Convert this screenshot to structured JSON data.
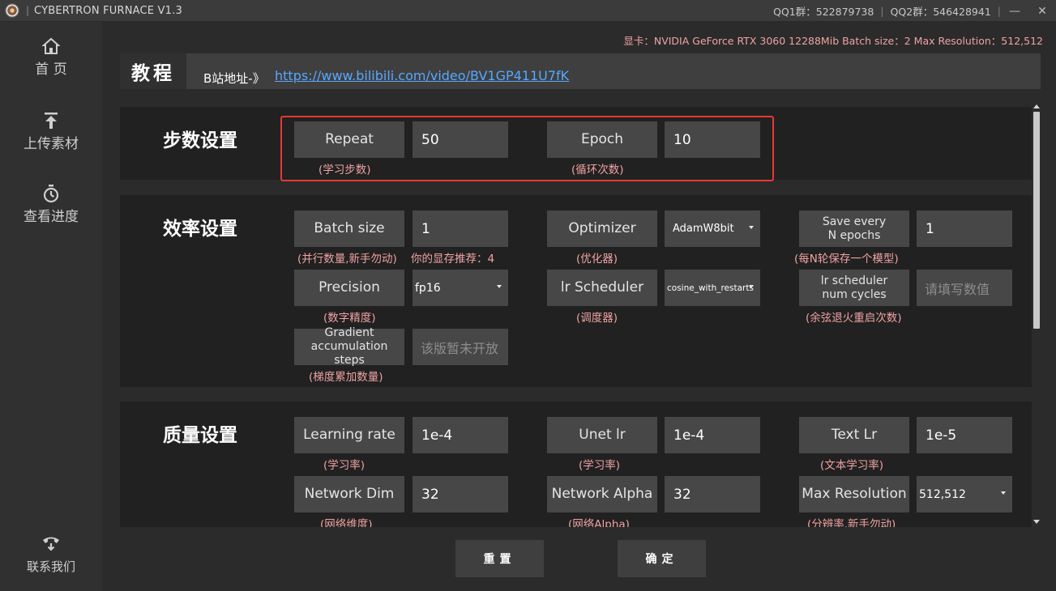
{
  "titlebar": {
    "app_title": "CYBERTRON FURNACE V1.3",
    "qq1": "QQ1群：522879738",
    "qq2": "QQ2群：546428941",
    "minimize": "—",
    "close": "✕"
  },
  "sidebar": {
    "items": [
      {
        "label": "首 页",
        "icon": "home-icon"
      },
      {
        "label": "上传素材",
        "icon": "upload-icon"
      },
      {
        "label": "查看进度",
        "icon": "stopwatch-icon"
      },
      {
        "label": "联系我们",
        "icon": "phone-icon"
      }
    ]
  },
  "gpu_info": "显卡：NVIDIA GeForce RTX 3060 12288Mib  Batch size：2  Max Resolution：512,512",
  "tutorial": {
    "title": "教程",
    "prefix": "B站地址-》",
    "link": "https://www.bilibili.com/video/BV1GP411U7fK"
  },
  "steps": {
    "title": "步数设置",
    "repeat_label": "Repeat",
    "repeat_value": "50",
    "repeat_hint": "(学习步数)",
    "epoch_label": "Epoch",
    "epoch_value": "10",
    "epoch_hint": "(循环次数)"
  },
  "efficiency": {
    "title": "效率设置",
    "batch_label": "Batch size",
    "batch_value": "1",
    "batch_hint": "(并行数量,新手勿动)",
    "batch_hint2": "你的显存推荐：4",
    "optimizer_label": "Optimizer",
    "optimizer_value": "AdamW8bit",
    "optimizer_hint": "(优化器)",
    "save_label": "Save every\nN epochs",
    "save_value": "1",
    "save_hint": "(每N轮保存一个模型)",
    "precision_label": "Precision",
    "precision_value": "fp16",
    "precision_hint": "(数字精度)",
    "scheduler_label": "lr Scheduler",
    "scheduler_value": "cosine_with_restarts",
    "scheduler_hint": "(调度器)",
    "cycles_label": "lr scheduler\nnum cycles",
    "cycles_placeholder": "请填写数值",
    "cycles_hint": "(余弦退火重启次数)",
    "grad_label": "Gradient\naccumulation steps",
    "grad_placeholder": "该版暂未开放",
    "grad_hint": "(梯度累加数量)"
  },
  "quality": {
    "title": "质量设置",
    "lr_label": "Learning rate",
    "lr_value": "1e-4",
    "lr_hint": "(学习率)",
    "unet_label": "Unet lr",
    "unet_value": "1e-4",
    "unet_hint": "(学习率)",
    "text_label": "Text Lr",
    "text_value": "1e-5",
    "text_hint": "(文本学习率)",
    "dim_label": "Network Dim",
    "dim_value": "32",
    "dim_hint": "(网络维度)",
    "alpha_label": "Network Alpha",
    "alpha_value": "32",
    "alpha_hint": "(网络Alpha)",
    "res_label": "Max Resolution",
    "res_value": "512,512",
    "res_hint": "(分辨率,新手勿动)"
  },
  "actions": {
    "reset": "重置",
    "confirm": "确定"
  },
  "colors": {
    "hint": "#f0a2a2",
    "link": "#56a8ff",
    "highlight": "#e53935"
  }
}
